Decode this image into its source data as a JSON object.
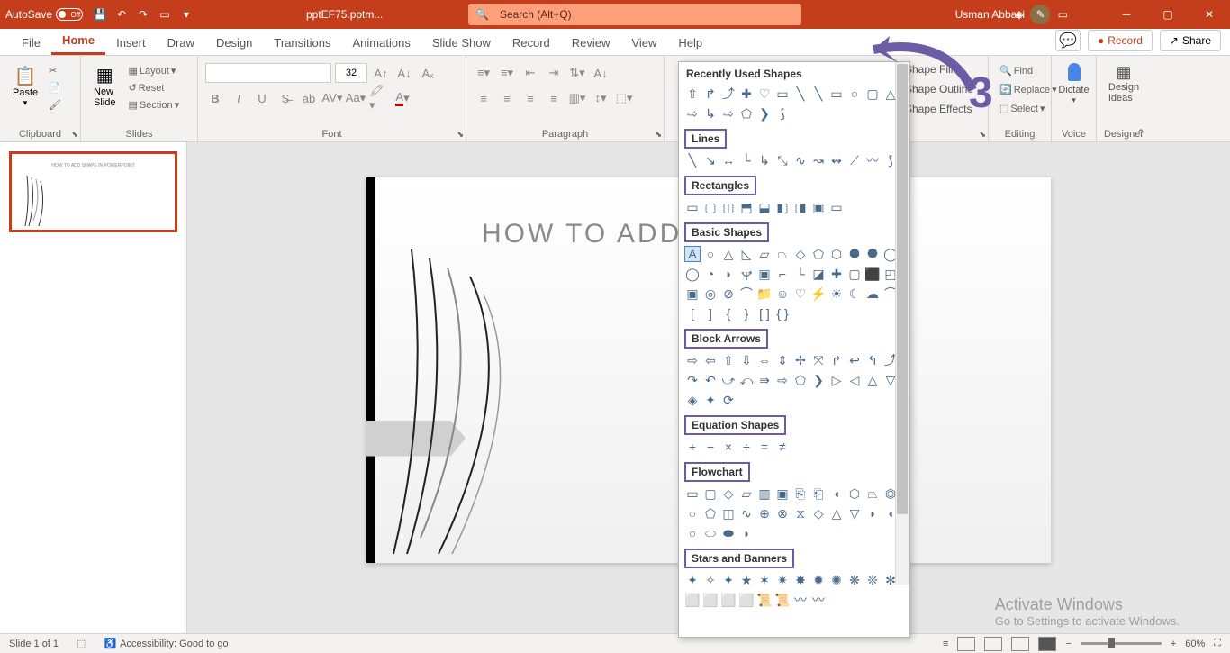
{
  "titlebar": {
    "autosave_label": "AutoSave",
    "autosave_state": "Off",
    "filename": "pptEF75.pptm...",
    "search_placeholder": "Search (Alt+Q)",
    "user_name": "Usman Abbasi"
  },
  "tabs": [
    "File",
    "Home",
    "Insert",
    "Draw",
    "Design",
    "Transitions",
    "Animations",
    "Slide Show",
    "Record",
    "Review",
    "View",
    "Help"
  ],
  "tab_active": "Home",
  "right_buttons": {
    "record": "Record",
    "share": "Share"
  },
  "ribbon": {
    "clipboard": {
      "paste": "Paste",
      "label": "Clipboard"
    },
    "slides": {
      "new_slide": "New\nSlide",
      "layout": "Layout",
      "reset": "Reset",
      "section": "Section",
      "label": "Slides"
    },
    "font": {
      "size": "32",
      "label": "Font"
    },
    "paragraph": {
      "label": "Paragraph"
    },
    "shape_fill": "Shape Fill",
    "shape_outline": "Shape Outline",
    "shape_effects": "Shape Effects",
    "editing": {
      "find": "Find",
      "replace": "Replace",
      "select": "Select",
      "label": "Editing"
    },
    "dictate": "Dictate",
    "design_ideas": "Design\nIdeas",
    "designer": "Designer"
  },
  "slide": {
    "number": "1",
    "title": "HOW TO ADD SHA",
    "thumb_title": "HOW TO ADD SHAPE IN POWERPOINT"
  },
  "shapes_gallery": {
    "recently_used": "Recently Used Shapes",
    "lines": "Lines",
    "rectangles": "Rectangles",
    "basic": "Basic Shapes",
    "block_arrows": "Block Arrows",
    "equation": "Equation Shapes",
    "flowchart": "Flowchart",
    "stars": "Stars and Banners"
  },
  "anno_number": "3",
  "activate": {
    "line1": "Activate Windows",
    "line2": "Go to Settings to activate Windows."
  },
  "statusbar": {
    "slide": "Slide 1 of 1",
    "accessibility": "Accessibility: Good to go",
    "zoom": "60%"
  }
}
